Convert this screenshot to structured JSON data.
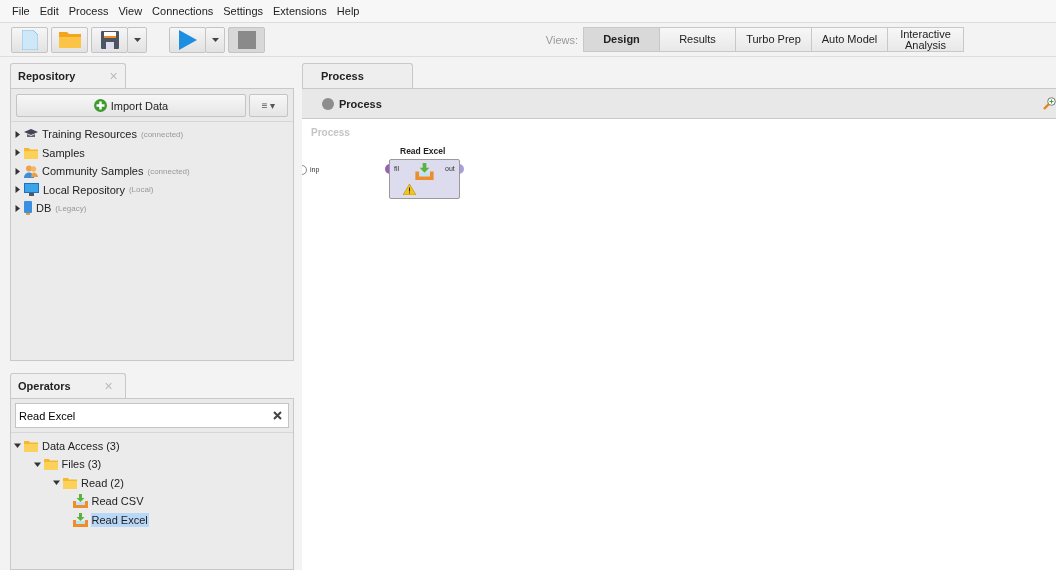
{
  "menu": [
    "File",
    "Edit",
    "Process",
    "View",
    "Connections",
    "Settings",
    "Extensions",
    "Help"
  ],
  "views": {
    "label": "Views:",
    "tabs": [
      {
        "label": "Design",
        "selected": true
      },
      {
        "label": "Results",
        "selected": false
      },
      {
        "label": "Turbo Prep",
        "selected": false
      },
      {
        "label": "Auto Model",
        "selected": false
      },
      {
        "label": "Interactive Analysis",
        "selected": false
      }
    ]
  },
  "repository": {
    "title": "Repository",
    "close": "×",
    "import_button": "Import Data",
    "menu_button": "≡ ▾",
    "items": [
      {
        "kind": "training",
        "name": "Training Resources",
        "note": "(connected)",
        "expanded": false
      },
      {
        "kind": "folder",
        "name": "Samples",
        "expanded": false
      },
      {
        "kind": "community",
        "name": "Community Samples",
        "note": "(connected)",
        "expanded": false
      },
      {
        "kind": "local",
        "name": "Local Repository",
        "note": "(Local)",
        "expanded": false
      },
      {
        "kind": "db",
        "name": "DB",
        "note": "(Legacy)",
        "expanded": false
      }
    ]
  },
  "operators": {
    "title": "Operators",
    "close": "×",
    "search": {
      "value": "Read Excel"
    },
    "tree": [
      {
        "kind": "folder",
        "name": "Data Access (3)",
        "expanded": true,
        "children": [
          {
            "kind": "folder",
            "name": "Files (3)",
            "expanded": true,
            "children": [
              {
                "kind": "folder",
                "name": "Read (2)",
                "expanded": true,
                "children": [
                  {
                    "kind": "operator",
                    "name": "Read CSV",
                    "selected": false
                  },
                  {
                    "kind": "operator",
                    "name": "Read Excel",
                    "selected": true
                  }
                ]
              }
            ]
          }
        ]
      }
    ]
  },
  "process": {
    "tab": "Process",
    "breadcrumb": "Process",
    "canvas_label": "Process",
    "input_port": "inp",
    "operator": {
      "name": "Read Excel",
      "in_port": "fil",
      "out_port": "out",
      "warning": true
    }
  }
}
